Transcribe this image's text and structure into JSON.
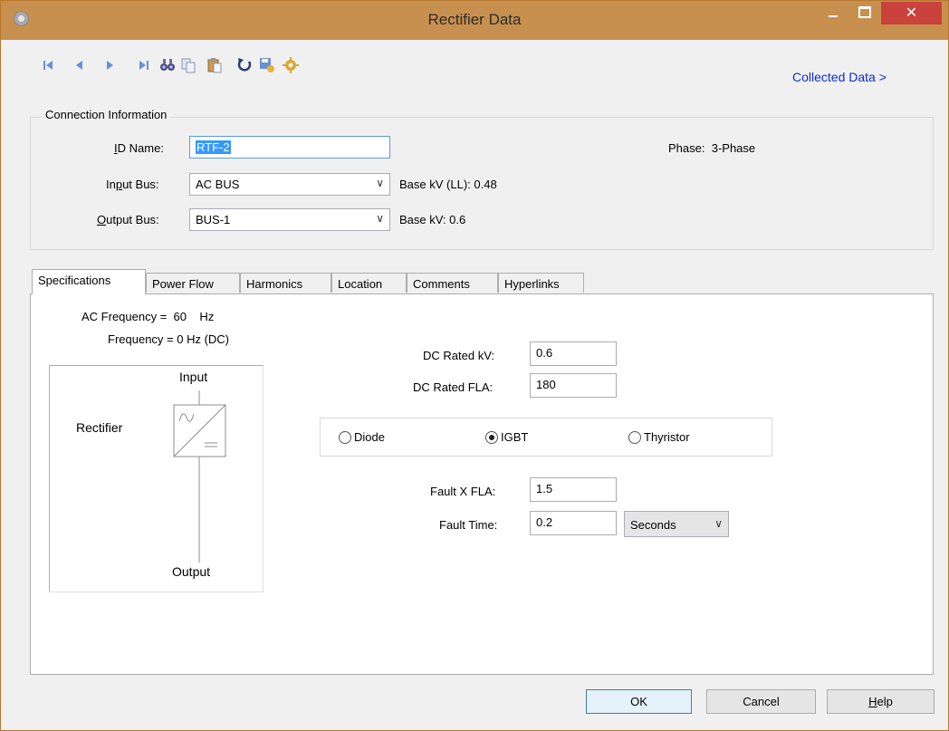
{
  "window": {
    "title": "Rectifier Data"
  },
  "toolbar": {
    "icons": [
      "first-record-icon",
      "previous-record-icon",
      "next-record-icon",
      "last-record-icon",
      "find-icon",
      "copy-icon",
      "paste-icon",
      "undo-icon",
      "save-library-icon",
      "settings-icon"
    ],
    "collected_data_link": "Collected Data >"
  },
  "connection": {
    "group_title": "Connection Information",
    "id_label_pre": "",
    "id_label_ul": "I",
    "id_label_post": "D Name:",
    "id_value": "RTF-2",
    "phase_label": "Phase:",
    "phase_value": "3-Phase",
    "input_label_pre": "In",
    "input_label_ul": "p",
    "input_label_post": "ut Bus:",
    "input_value": "AC BUS",
    "input_base": "Base kV (LL): 0.48",
    "output_label_pre": "",
    "output_label_ul": "O",
    "output_label_post": "utput Bus:",
    "output_value": "BUS-1",
    "output_base": "Base kV: 0.6"
  },
  "tabs": [
    "Specifications",
    "Power Flow",
    "Harmonics",
    "Location",
    "Comments",
    "Hyperlinks"
  ],
  "specs": {
    "ac_freq": "AC Frequency =  60    Hz",
    "freq": "Frequency =  0 Hz (DC)",
    "diagram": {
      "input": "Input",
      "rectifier": "Rectifier",
      "output": "Output"
    },
    "dc_kv_label": "DC Rated kV:",
    "dc_kv_value": "0.6",
    "dc_fla_label": "DC Rated FLA:",
    "dc_fla_value": "180",
    "radios": [
      {
        "label": "Diode",
        "selected": false
      },
      {
        "label": "IGBT",
        "selected": true
      },
      {
        "label": "Thyristor",
        "selected": false
      }
    ],
    "fault_x_label": "Fault X FLA:",
    "fault_x_value": "1.5",
    "fault_time_label": "Fault Time:",
    "fault_time_value": "0.2",
    "fault_time_unit": "Seconds"
  },
  "buttons": {
    "ok": "OK",
    "cancel": "Cancel",
    "help_ul": "H",
    "help_rest": "elp"
  },
  "colors": {
    "titlebar": "#c8904e",
    "close": "#c9423b",
    "link": "#0a2bd8",
    "selection": "#3399ff",
    "toolbar_icons": "#6b8fd6"
  }
}
